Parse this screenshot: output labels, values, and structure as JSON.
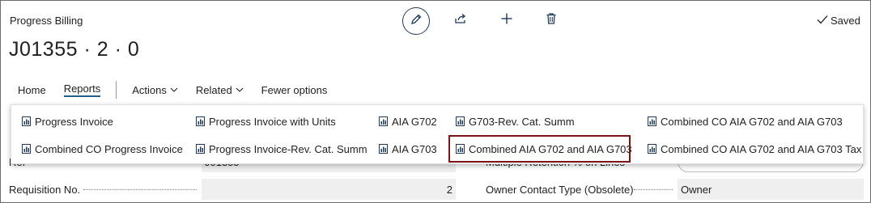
{
  "page": {
    "caption": "Progress Billing",
    "record_title": "J01355 · 2 · 0",
    "saved_label": "Saved"
  },
  "toolbar": {
    "edit": "pencil-icon",
    "share": "share-icon",
    "new": "plus-icon",
    "delete": "trash-icon"
  },
  "menu": {
    "home": "Home",
    "reports": "Reports",
    "actions": "Actions",
    "related": "Related",
    "fewer": "Fewer options"
  },
  "reports": [
    {
      "label": "Progress Invoice"
    },
    {
      "label": "Combined CO Progress Invoice"
    },
    {
      "label": "Progress Invoice with Units"
    },
    {
      "label": "Progress Invoice-Rev. Cat. Summ"
    },
    {
      "label": "AIA G702"
    },
    {
      "label": "AIA G703"
    },
    {
      "label": "G703-Rev. Cat. Summ"
    },
    {
      "label": "Combined AIA G702 and AIA G703"
    },
    {
      "label": "Combined CO AIA G702 and AIA G703"
    },
    {
      "label": "Combined CO AIA G702 and AIA G703 Tax"
    }
  ],
  "fields": {
    "ref_label": "Ref",
    "ref_value": "J01355",
    "multiple_retention_label": "Multiple Retention % on Lines",
    "requisition_label": "Requisition No.",
    "requisition_value": "2",
    "owner_contact_label": "Owner Contact Type (Obsolete)",
    "owner_contact_value": "Owner"
  },
  "colors": {
    "highlight": "#7b1416",
    "accent": "#1f5f8b",
    "field_bg": "#efefef"
  }
}
